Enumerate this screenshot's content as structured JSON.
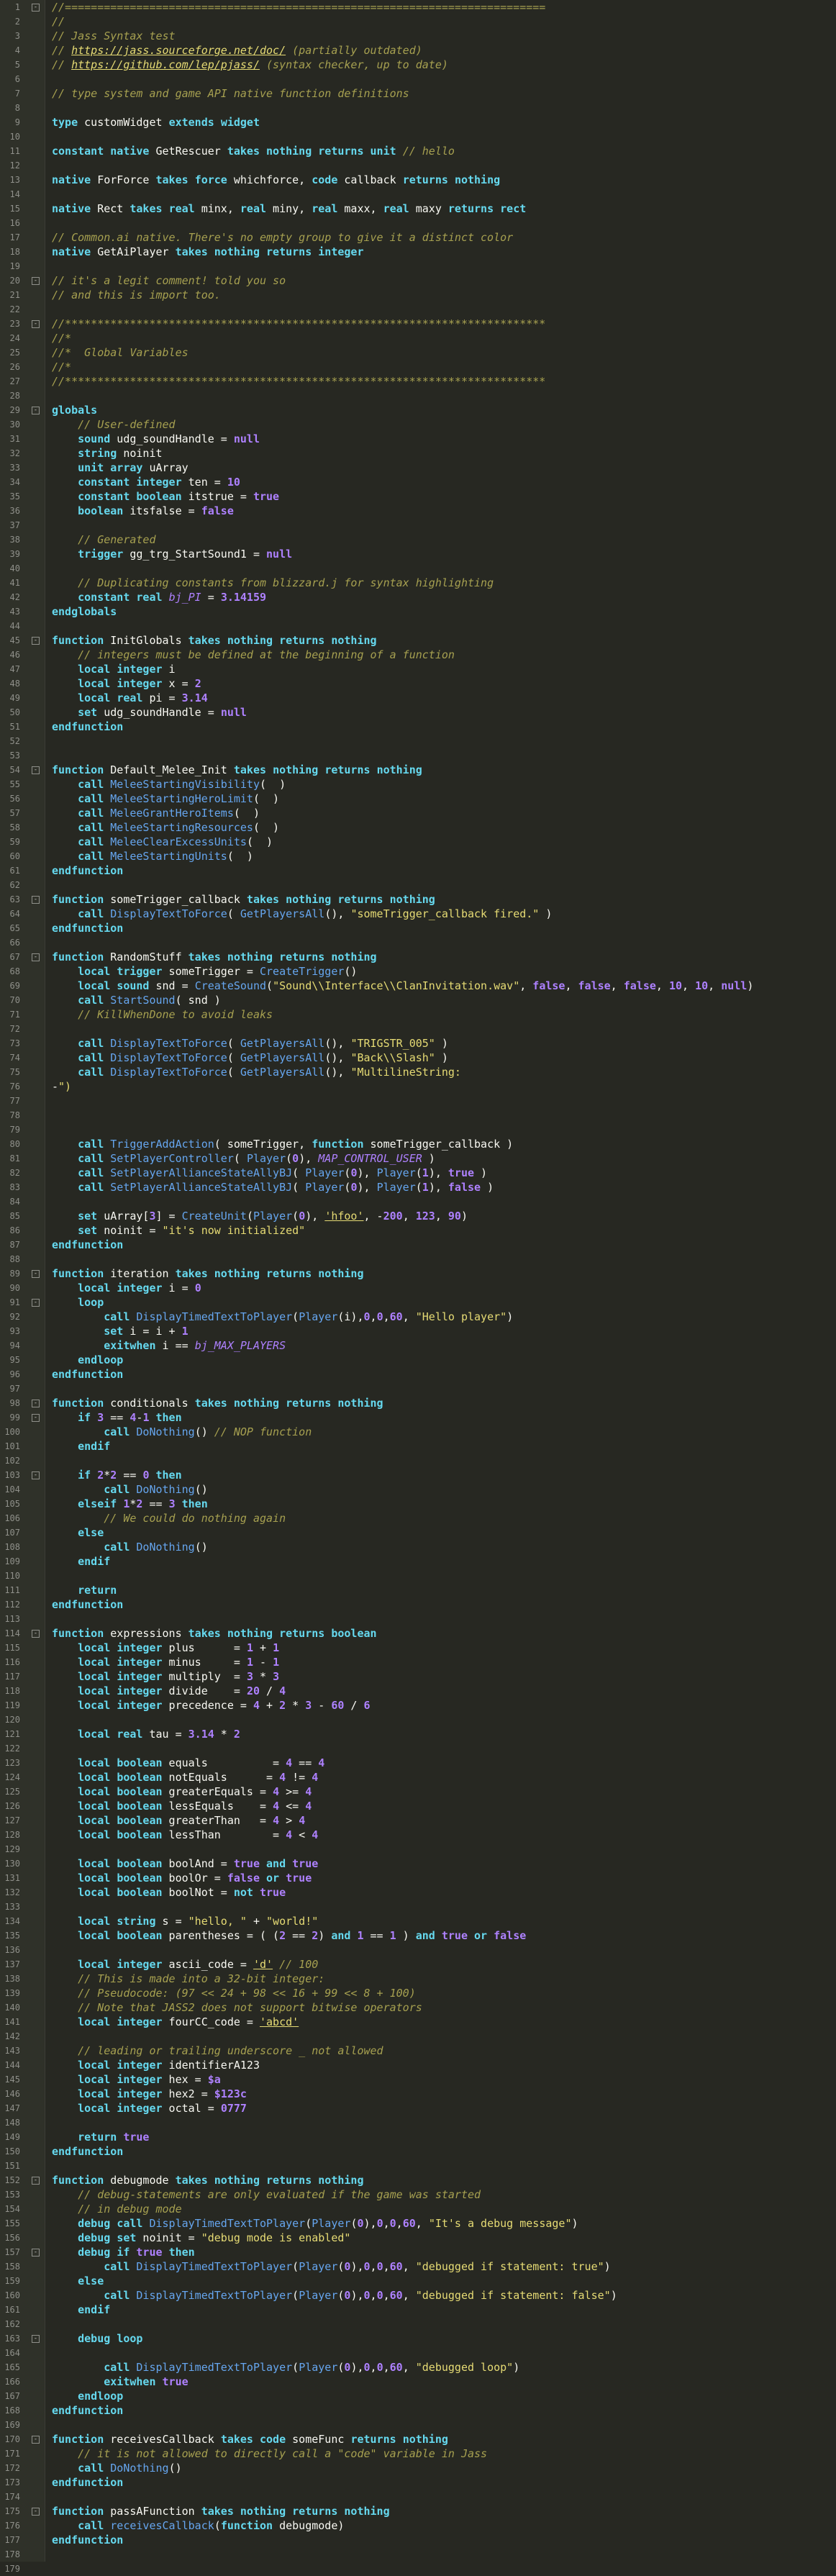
{
  "editor": {
    "language": "jass",
    "colors": {
      "background": "#272822",
      "keyword": "#66d9ef",
      "number": "#ae81ff",
      "string": "#e6db74",
      "comment": "#a6a050",
      "function": "#66a6ef"
    }
  },
  "lines": [
    {
      "n": "1",
      "fold": "-",
      "code": "//=========================================================================="
    },
    {
      "n": "2",
      "code": "//"
    },
    {
      "n": "3",
      "code": "// Jass Syntax test"
    },
    {
      "n": "4",
      "code": "// https://jass.sourceforge.net/doc/ (partially outdated)"
    },
    {
      "n": "5",
      "code": "// https://github.com/lep/pjass/ (syntax checker, up to date)"
    },
    {
      "n": "6",
      "code": ""
    },
    {
      "n": "7",
      "code": "// type system and game API native function definitions"
    },
    {
      "n": "8",
      "code": ""
    },
    {
      "n": "9",
      "code": "type customWidget extends widget"
    },
    {
      "n": "10",
      "code": ""
    },
    {
      "n": "11",
      "code": "constant native GetRescuer takes nothing returns unit // hello"
    },
    {
      "n": "12",
      "code": ""
    },
    {
      "n": "13",
      "code": "native ForForce takes force whichforce, code callback returns nothing"
    },
    {
      "n": "14",
      "code": ""
    },
    {
      "n": "15",
      "code": "native Rect takes real minx, real miny, real maxx, real maxy returns rect"
    },
    {
      "n": "16",
      "code": ""
    },
    {
      "n": "17",
      "code": "// Common.ai native. There's no empty group to give it a distinct color"
    },
    {
      "n": "18",
      "code": "native GetAiPlayer takes nothing returns integer"
    },
    {
      "n": "19",
      "code": ""
    },
    {
      "n": "20",
      "fold": "-",
      "code": "// it's a legit comment! told you so"
    },
    {
      "n": "21",
      "code": "// and this is import too."
    },
    {
      "n": "22",
      "code": ""
    },
    {
      "n": "23",
      "fold": "-",
      "code": "//**************************************************************************"
    },
    {
      "n": "24",
      "code": "//*"
    },
    {
      "n": "25",
      "code": "//*  Global Variables"
    },
    {
      "n": "26",
      "code": "//*"
    },
    {
      "n": "27",
      "code": "//**************************************************************************"
    },
    {
      "n": "28",
      "code": ""
    },
    {
      "n": "29",
      "fold": "-",
      "code": "globals"
    },
    {
      "n": "30",
      "code": "    // User-defined"
    },
    {
      "n": "31",
      "code": "    sound udg_soundHandle = null"
    },
    {
      "n": "32",
      "code": "    string noinit"
    },
    {
      "n": "33",
      "code": "    unit array uArray"
    },
    {
      "n": "34",
      "code": "    constant integer ten = 10"
    },
    {
      "n": "35",
      "code": "    constant boolean itstrue = true"
    },
    {
      "n": "36",
      "code": "    boolean itsfalse = false"
    },
    {
      "n": "37",
      "code": ""
    },
    {
      "n": "38",
      "code": "    // Generated"
    },
    {
      "n": "39",
      "code": "    trigger gg_trg_StartSound1 = null"
    },
    {
      "n": "40",
      "code": ""
    },
    {
      "n": "41",
      "code": "    // Duplicating constants from blizzard.j for syntax highlighting"
    },
    {
      "n": "42",
      "code": "    constant real bj_PI = 3.14159"
    },
    {
      "n": "43",
      "code": "endglobals"
    },
    {
      "n": "44",
      "code": ""
    },
    {
      "n": "45",
      "fold": "-",
      "code": "function InitGlobals takes nothing returns nothing"
    },
    {
      "n": "46",
      "code": "    // integers must be defined at the beginning of a function"
    },
    {
      "n": "47",
      "code": "    local integer i"
    },
    {
      "n": "48",
      "code": "    local integer x = 2"
    },
    {
      "n": "49",
      "code": "    local real pi = 3.14"
    },
    {
      "n": "50",
      "code": "    set udg_soundHandle = null"
    },
    {
      "n": "51",
      "code": "endfunction"
    },
    {
      "n": "52",
      "code": ""
    },
    {
      "n": "53",
      "code": ""
    },
    {
      "n": "54",
      "fold": "-",
      "code": "function Default_Melee_Init takes nothing returns nothing"
    },
    {
      "n": "55",
      "code": "    call MeleeStartingVisibility(  )"
    },
    {
      "n": "56",
      "code": "    call MeleeStartingHeroLimit(  )"
    },
    {
      "n": "57",
      "code": "    call MeleeGrantHeroItems(  )"
    },
    {
      "n": "58",
      "code": "    call MeleeStartingResources(  )"
    },
    {
      "n": "59",
      "code": "    call MeleeClearExcessUnits(  )"
    },
    {
      "n": "60",
      "code": "    call MeleeStartingUnits(  )"
    },
    {
      "n": "61",
      "code": "endfunction"
    },
    {
      "n": "62",
      "code": ""
    },
    {
      "n": "63",
      "fold": "-",
      "code": "function someTrigger_callback takes nothing returns nothing"
    },
    {
      "n": "64",
      "code": "    call DisplayTextToForce( GetPlayersAll(), \"someTrigger_callback fired.\" )"
    },
    {
      "n": "65",
      "code": "endfunction"
    },
    {
      "n": "66",
      "code": ""
    },
    {
      "n": "67",
      "fold": "-",
      "code": "function RandomStuff takes nothing returns nothing"
    },
    {
      "n": "68",
      "code": "    local trigger someTrigger = CreateTrigger()"
    },
    {
      "n": "69",
      "code": "    local sound snd = CreateSound(\"Sound\\\\Interface\\\\ClanInvitation.wav\", false, false, false, 10, 10, null)"
    },
    {
      "n": "70",
      "code": "    call StartSound( snd )"
    },
    {
      "n": "71",
      "code": "    // KillWhenDone to avoid leaks"
    },
    {
      "n": "72",
      "code": ""
    },
    {
      "n": "73",
      "code": "    call DisplayTextToForce( GetPlayersAll(), \"TRIGSTR_005\" )"
    },
    {
      "n": "74",
      "code": "    call DisplayTextToForce( GetPlayersAll(), \"Back\\\\Slash\" )"
    },
    {
      "n": "75",
      "code": "    call DisplayTextToForce( GetPlayersAll(), \"MultilineString:"
    },
    {
      "n": "76",
      "code": "-\")"
    },
    {
      "n": "77",
      "code": ""
    },
    {
      "n": "78",
      "code": ""
    },
    {
      "n": "79",
      "code": ""
    },
    {
      "n": "80",
      "code": "    call TriggerAddAction( someTrigger, function someTrigger_callback )"
    },
    {
      "n": "81",
      "code": "    call SetPlayerController( Player(0), MAP_CONTROL_USER )"
    },
    {
      "n": "82",
      "code": "    call SetPlayerAllianceStateAllyBJ( Player(0), Player(1), true )"
    },
    {
      "n": "83",
      "code": "    call SetPlayerAllianceStateAllyBJ( Player(0), Player(1), false )"
    },
    {
      "n": "84",
      "code": ""
    },
    {
      "n": "85",
      "code": "    set uArray[3] = CreateUnit(Player(0), 'hfoo', -200, 123, 90)"
    },
    {
      "n": "86",
      "code": "    set noinit = \"it's now initialized\""
    },
    {
      "n": "87",
      "code": "endfunction"
    },
    {
      "n": "88",
      "code": ""
    },
    {
      "n": "89",
      "fold": "-",
      "code": "function iteration takes nothing returns nothing"
    },
    {
      "n": "90",
      "code": "    local integer i = 0"
    },
    {
      "n": "91",
      "fold": "-",
      "code": "    loop"
    },
    {
      "n": "92",
      "code": "        call DisplayTimedTextToPlayer(Player(i),0,0,60, \"Hello player\")"
    },
    {
      "n": "93",
      "code": "        set i = i + 1"
    },
    {
      "n": "94",
      "code": "        exitwhen i == bj_MAX_PLAYERS"
    },
    {
      "n": "95",
      "code": "    endloop"
    },
    {
      "n": "96",
      "code": "endfunction"
    },
    {
      "n": "97",
      "code": ""
    },
    {
      "n": "98",
      "fold": "-",
      "code": "function conditionals takes nothing returns nothing"
    },
    {
      "n": "99",
      "fold": "-",
      "code": "    if 3 == 4-1 then"
    },
    {
      "n": "100",
      "code": "        call DoNothing() // NOP function"
    },
    {
      "n": "101",
      "code": "    endif"
    },
    {
      "n": "102",
      "code": ""
    },
    {
      "n": "103",
      "fold": "-",
      "code": "    if 2*2 == 0 then"
    },
    {
      "n": "104",
      "code": "        call DoNothing()"
    },
    {
      "n": "105",
      "code": "    elseif 1*2 == 3 then"
    },
    {
      "n": "106",
      "code": "        // We could do nothing again"
    },
    {
      "n": "107",
      "code": "    else"
    },
    {
      "n": "108",
      "code": "        call DoNothing()"
    },
    {
      "n": "109",
      "code": "    endif"
    },
    {
      "n": "110",
      "code": ""
    },
    {
      "n": "111",
      "code": "    return"
    },
    {
      "n": "112",
      "code": "endfunction"
    },
    {
      "n": "113",
      "code": ""
    },
    {
      "n": "114",
      "fold": "-",
      "code": "function expressions takes nothing returns boolean"
    },
    {
      "n": "115",
      "code": "    local integer plus      = 1 + 1"
    },
    {
      "n": "116",
      "code": "    local integer minus     = 1 - 1"
    },
    {
      "n": "117",
      "code": "    local integer multiply  = 3 * 3"
    },
    {
      "n": "118",
      "code": "    local integer divide    = 20 / 4"
    },
    {
      "n": "119",
      "code": "    local integer precedence = 4 + 2 * 3 - 60 / 6"
    },
    {
      "n": "120",
      "code": ""
    },
    {
      "n": "121",
      "code": "    local real tau = 3.14 * 2"
    },
    {
      "n": "122",
      "code": ""
    },
    {
      "n": "123",
      "code": "    local boolean equals          = 4 == 4"
    },
    {
      "n": "124",
      "code": "    local boolean notEquals      = 4 != 4"
    },
    {
      "n": "125",
      "code": "    local boolean greaterEquals = 4 >= 4"
    },
    {
      "n": "126",
      "code": "    local boolean lessEquals    = 4 <= 4"
    },
    {
      "n": "127",
      "code": "    local boolean greaterThan   = 4 > 4"
    },
    {
      "n": "128",
      "code": "    local boolean lessThan        = 4 < 4"
    },
    {
      "n": "129",
      "code": ""
    },
    {
      "n": "130",
      "code": "    local boolean boolAnd = true and true"
    },
    {
      "n": "131",
      "code": "    local boolean boolOr = false or true"
    },
    {
      "n": "132",
      "code": "    local boolean boolNot = not true"
    },
    {
      "n": "133",
      "code": ""
    },
    {
      "n": "134",
      "code": "    local string s = \"hello, \" + \"world!\""
    },
    {
      "n": "135",
      "code": "    local boolean parentheses = ( (2 == 2) and 1 == 1 ) and true or false"
    },
    {
      "n": "136",
      "code": ""
    },
    {
      "n": "137",
      "code": "    local integer ascii_code = 'd' // 100"
    },
    {
      "n": "138",
      "code": "    // This is made into a 32-bit integer:"
    },
    {
      "n": "139",
      "code": "    // Pseudocode: (97 << 24 + 98 << 16 + 99 << 8 + 100)"
    },
    {
      "n": "140",
      "code": "    // Note that JASS2 does not support bitwise operators"
    },
    {
      "n": "141",
      "code": "    local integer fourCC_code = 'abcd'"
    },
    {
      "n": "142",
      "code": ""
    },
    {
      "n": "143",
      "code": "    // leading or trailing underscore _ not allowed"
    },
    {
      "n": "144",
      "code": "    local integer identifierA123"
    },
    {
      "n": "145",
      "code": "    local integer hex = $a"
    },
    {
      "n": "146",
      "code": "    local integer hex2 = $123c"
    },
    {
      "n": "147",
      "code": "    local integer octal = 0777"
    },
    {
      "n": "148",
      "code": ""
    },
    {
      "n": "149",
      "code": "    return true"
    },
    {
      "n": "150",
      "code": "endfunction"
    },
    {
      "n": "151",
      "code": ""
    },
    {
      "n": "152",
      "fold": "-",
      "code": "function debugmode takes nothing returns nothing"
    },
    {
      "n": "153",
      "code": "    // debug-statements are only evaluated if the game was started"
    },
    {
      "n": "154",
      "code": "    // in debug mode"
    },
    {
      "n": "155",
      "code": "    debug call DisplayTimedTextToPlayer(Player(0),0,0,60, \"It's a debug message\")"
    },
    {
      "n": "156",
      "code": "    debug set noinit = \"debug mode is enabled\""
    },
    {
      "n": "157",
      "fold": "-",
      "code": "    debug if true then"
    },
    {
      "n": "158",
      "code": "        call DisplayTimedTextToPlayer(Player(0),0,0,60, \"debugged if statement: true\")"
    },
    {
      "n": "159",
      "code": "    else"
    },
    {
      "n": "160",
      "code": "        call DisplayTimedTextToPlayer(Player(0),0,0,60, \"debugged if statement: false\")"
    },
    {
      "n": "161",
      "code": "    endif"
    },
    {
      "n": "162",
      "code": ""
    },
    {
      "n": "163",
      "fold": "-",
      "code": "    debug loop"
    },
    {
      "n": "164",
      "code": ""
    },
    {
      "n": "165",
      "code": "        call DisplayTimedTextToPlayer(Player(0),0,0,60, \"debugged loop\")"
    },
    {
      "n": "166",
      "code": "        exitwhen true"
    },
    {
      "n": "167",
      "code": "    endloop"
    },
    {
      "n": "168",
      "code": "endfunction"
    },
    {
      "n": "169",
      "code": ""
    },
    {
      "n": "170",
      "fold": "-",
      "code": "function receivesCallback takes code someFunc returns nothing"
    },
    {
      "n": "171",
      "code": "    // it is not allowed to directly call a \"code\" variable in Jass"
    },
    {
      "n": "172",
      "code": "    call DoNothing()"
    },
    {
      "n": "173",
      "code": "endfunction"
    },
    {
      "n": "174",
      "code": ""
    },
    {
      "n": "175",
      "fold": "-",
      "code": "function passAFunction takes nothing returns nothing"
    },
    {
      "n": "176",
      "code": "    call receivesCallback(function debugmode)"
    },
    {
      "n": "177",
      "code": "endfunction"
    },
    {
      "n": "178",
      "code": ""
    },
    {
      "n": "179",
      "code": ""
    }
  ]
}
